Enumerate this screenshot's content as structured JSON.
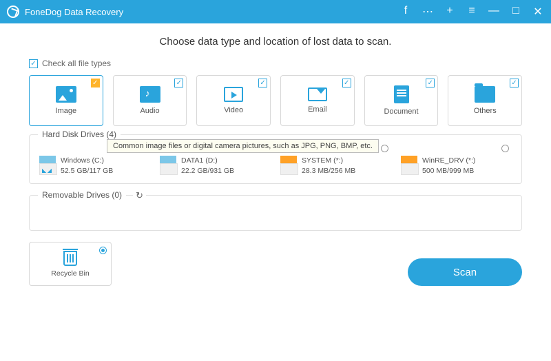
{
  "titlebar": {
    "title": "FoneDog Data Recovery"
  },
  "heading": "Choose data type and location of lost data to scan.",
  "check_all": "Check all file types",
  "types": [
    {
      "label": "Image",
      "icon": "image",
      "selected": true
    },
    {
      "label": "Audio",
      "icon": "audio",
      "selected": false
    },
    {
      "label": "Video",
      "icon": "video",
      "selected": false
    },
    {
      "label": "Email",
      "icon": "email",
      "selected": false
    },
    {
      "label": "Document",
      "icon": "doc",
      "selected": false
    },
    {
      "label": "Others",
      "icon": "folder",
      "selected": false
    }
  ],
  "tooltip": "Common image files or digital camera pictures, such as JPG, PNG, BMP, etc.",
  "sections": {
    "hdd_title": "Hard Disk Drives (4)",
    "removable_title": "Removable Drives (0)"
  },
  "drives": [
    {
      "name": "Windows (C:)",
      "size": "52.5 GB/117 GB",
      "color": "blue",
      "win": true
    },
    {
      "name": "DATA1 (D:)",
      "size": "22.2 GB/931 GB",
      "color": "blue",
      "win": false
    },
    {
      "name": "SYSTEM (*:)",
      "size": "28.3 MB/256 MB",
      "color": "orange",
      "win": false
    },
    {
      "name": "WinRE_DRV (*:)",
      "size": "500 MB/999 MB",
      "color": "orange",
      "win": false
    }
  ],
  "recycle": {
    "label": "Recycle Bin"
  },
  "scan_btn": "Scan"
}
